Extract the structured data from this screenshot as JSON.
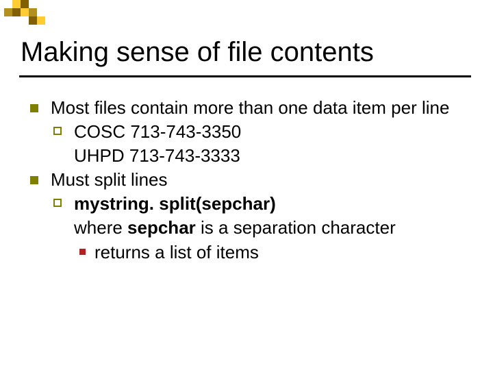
{
  "title": "Making sense of file contents",
  "body": [
    {
      "text": "Most files contain more than one data item per line",
      "children": [
        {
          "lines": [
            "COSC 713-743-3350",
            "UHPD 713-743-3333"
          ]
        }
      ]
    },
    {
      "text": "Must split lines",
      "children": [
        {
          "bold": "mystring. split(sepchar)",
          "line2_prefix": "where ",
          "line2_bold": "sepchar",
          "line2_suffix": " is a separation character",
          "children": [
            {
              "text": "returns a list of items"
            }
          ]
        }
      ]
    }
  ]
}
